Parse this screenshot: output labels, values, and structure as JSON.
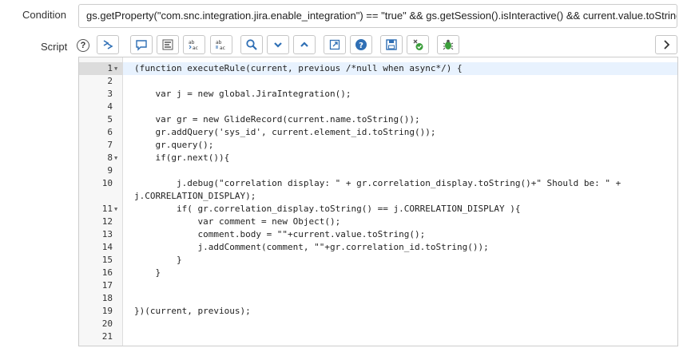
{
  "condition": {
    "label": "Condition",
    "value": "gs.getProperty(\"com.snc.integration.jira.enable_integration\") == \"true\" && gs.getSession().isInteractive() && current.value.toString().sta"
  },
  "script": {
    "label": "Script",
    "help_glyph": "?"
  },
  "toolbar": {
    "icons": [
      "script-toggle-icon",
      "comment-icon",
      "format-icon",
      "replace-icon",
      "replace-all-icon",
      "search-icon",
      "fold-down-icon",
      "fold-up-icon",
      "fullscreen-icon",
      "help-icon",
      "save-icon",
      "check-syntax-icon",
      "debug-icon",
      "expand-arrow-icon"
    ]
  },
  "editor": {
    "lines": [
      {
        "n": "1",
        "text": "(function executeRule(current, previous /*null when async*/) {"
      },
      {
        "n": "2",
        "text": ""
      },
      {
        "n": "3",
        "text": "    var j = new global.JiraIntegration();"
      },
      {
        "n": "4",
        "text": ""
      },
      {
        "n": "5",
        "text": "    var gr = new GlideRecord(current.name.toString());"
      },
      {
        "n": "6",
        "text": "    gr.addQuery('sys_id', current.element_id.toString());"
      },
      {
        "n": "7",
        "text": "    gr.query();"
      },
      {
        "n": "8",
        "text": "    if(gr.next()){"
      },
      {
        "n": "9",
        "text": ""
      },
      {
        "n": "10",
        "text": "        j.debug(\"correlation display: \" + gr.correlation_display.toString()+\" Should be: \" +"
      },
      {
        "n": "",
        "text": "j.CORRELATION_DISPLAY);"
      },
      {
        "n": "11",
        "text": "        if( gr.correlation_display.toString() == j.CORRELATION_DISPLAY ){"
      },
      {
        "n": "12",
        "text": "            var comment = new Object();"
      },
      {
        "n": "13",
        "text": "            comment.body = \"\"+current.value.toString();"
      },
      {
        "n": "14",
        "text": "            j.addComment(comment, \"\"+gr.correlation_id.toString());"
      },
      {
        "n": "15",
        "text": "        }"
      },
      {
        "n": "16",
        "text": "    }"
      },
      {
        "n": "17",
        "text": ""
      },
      {
        "n": "18",
        "text": ""
      },
      {
        "n": "19",
        "text": "})(current, previous);"
      },
      {
        "n": "20",
        "text": ""
      },
      {
        "n": "21",
        "text": ""
      }
    ]
  }
}
